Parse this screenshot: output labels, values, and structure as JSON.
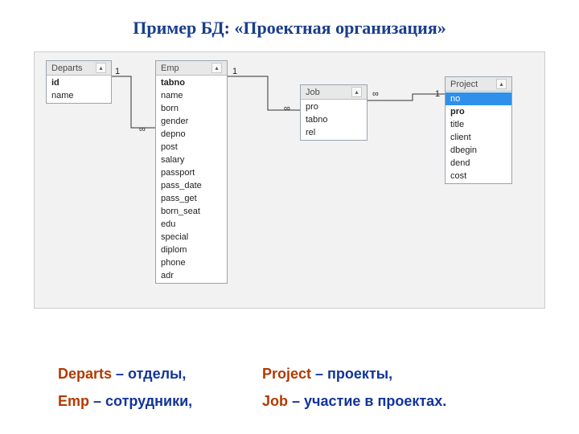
{
  "title": "Пример БД: «Проектная организация»",
  "tables": {
    "departs": {
      "name": "Departs",
      "fields": [
        "id",
        "name"
      ],
      "bold": [
        "id"
      ]
    },
    "emp": {
      "name": "Emp",
      "fields": [
        "tabno",
        "name",
        "born",
        "gender",
        "depno",
        "post",
        "salary",
        "passport",
        "pass_date",
        "pass_get",
        "born_seat",
        "edu",
        "special",
        "diplom",
        "phone",
        "adr"
      ],
      "bold": [
        "tabno"
      ]
    },
    "job": {
      "name": "Job",
      "fields": [
        "pro",
        "tabno",
        "rel"
      ],
      "bold": []
    },
    "project": {
      "name": "Project",
      "fields": [
        "no",
        "pro",
        "title",
        "client",
        "dbegin",
        "dend",
        "cost"
      ],
      "bold": [
        "pro"
      ],
      "selected": [
        "no"
      ]
    }
  },
  "relationships": [
    {
      "one": "Departs.id",
      "many": "Emp.depno"
    },
    {
      "one": "Emp.tabno",
      "many": "Job.tabno"
    },
    {
      "one": "Project.no",
      "many": "Job.pro"
    }
  ],
  "cardinality": {
    "one": "1",
    "many": "∞"
  },
  "legend": {
    "row1": [
      {
        "term": "Departs",
        "desc": "– отделы,"
      },
      {
        "term": "Project",
        "desc": "– проекты,"
      }
    ],
    "row2": [
      {
        "term": "Emp",
        "desc": "– сотрудники,"
      },
      {
        "term": "Job",
        "desc": "– участие в проектах."
      }
    ]
  },
  "chart_data": {
    "type": "table",
    "description": "Entity-relationship diagram of database 'Проектная организация'",
    "entities": [
      {
        "name": "Departs",
        "pk": "id",
        "attributes": [
          "id",
          "name"
        ]
      },
      {
        "name": "Emp",
        "pk": "tabno",
        "attributes": [
          "tabno",
          "name",
          "born",
          "gender",
          "depno",
          "post",
          "salary",
          "passport",
          "pass_date",
          "pass_get",
          "born_seat",
          "edu",
          "special",
          "diplom",
          "phone",
          "adr"
        ]
      },
      {
        "name": "Job",
        "pk": null,
        "attributes": [
          "pro",
          "tabno",
          "rel"
        ]
      },
      {
        "name": "Project",
        "pk": "pro",
        "attributes": [
          "no",
          "pro",
          "title",
          "client",
          "dbegin",
          "dend",
          "cost"
        ]
      }
    ],
    "relationships": [
      {
        "from": "Departs",
        "to": "Emp",
        "cardinality": "1:∞"
      },
      {
        "from": "Emp",
        "to": "Job",
        "cardinality": "1:∞"
      },
      {
        "from": "Project",
        "to": "Job",
        "cardinality": "1:∞"
      }
    ]
  }
}
